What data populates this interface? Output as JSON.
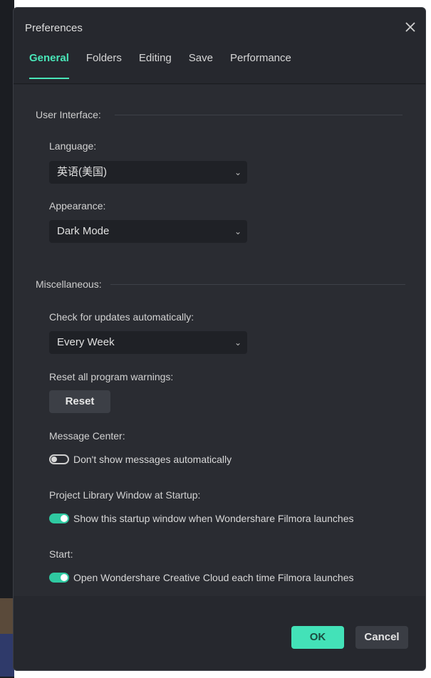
{
  "dialog": {
    "title": "Preferences",
    "close_icon": "close-icon"
  },
  "tabs": [
    {
      "label": "General",
      "active": true
    },
    {
      "label": "Folders",
      "active": false
    },
    {
      "label": "Editing",
      "active": false
    },
    {
      "label": "Save",
      "active": false
    },
    {
      "label": "Performance",
      "active": false
    }
  ],
  "user_interface": {
    "heading": "User Interface:",
    "language_label": "Language:",
    "language_value": "英语(美国)",
    "appearance_label": "Appearance:",
    "appearance_value": "Dark Mode"
  },
  "misc": {
    "heading": "Miscellaneous:",
    "updates_label": "Check for updates automatically:",
    "updates_value": "Every Week",
    "reset_label": "Reset all program warnings:",
    "reset_button": "Reset",
    "message_center_label": "Message Center:",
    "message_toggle_text": "Don't show messages automatically",
    "message_toggle_on": false,
    "project_library_label": "Project Library Window at Startup:",
    "project_toggle_text": "Show this startup window when Wondershare Filmora launches",
    "project_toggle_on": true,
    "start_label": "Start:",
    "start_toggle_text": "Open Wondershare Creative Cloud each time Filmora launches",
    "start_toggle_on": true
  },
  "footer": {
    "ok_label": "OK",
    "cancel_label": "Cancel"
  },
  "colors": {
    "accent": "#43e2b8",
    "dialog_bg": "#26282e"
  }
}
